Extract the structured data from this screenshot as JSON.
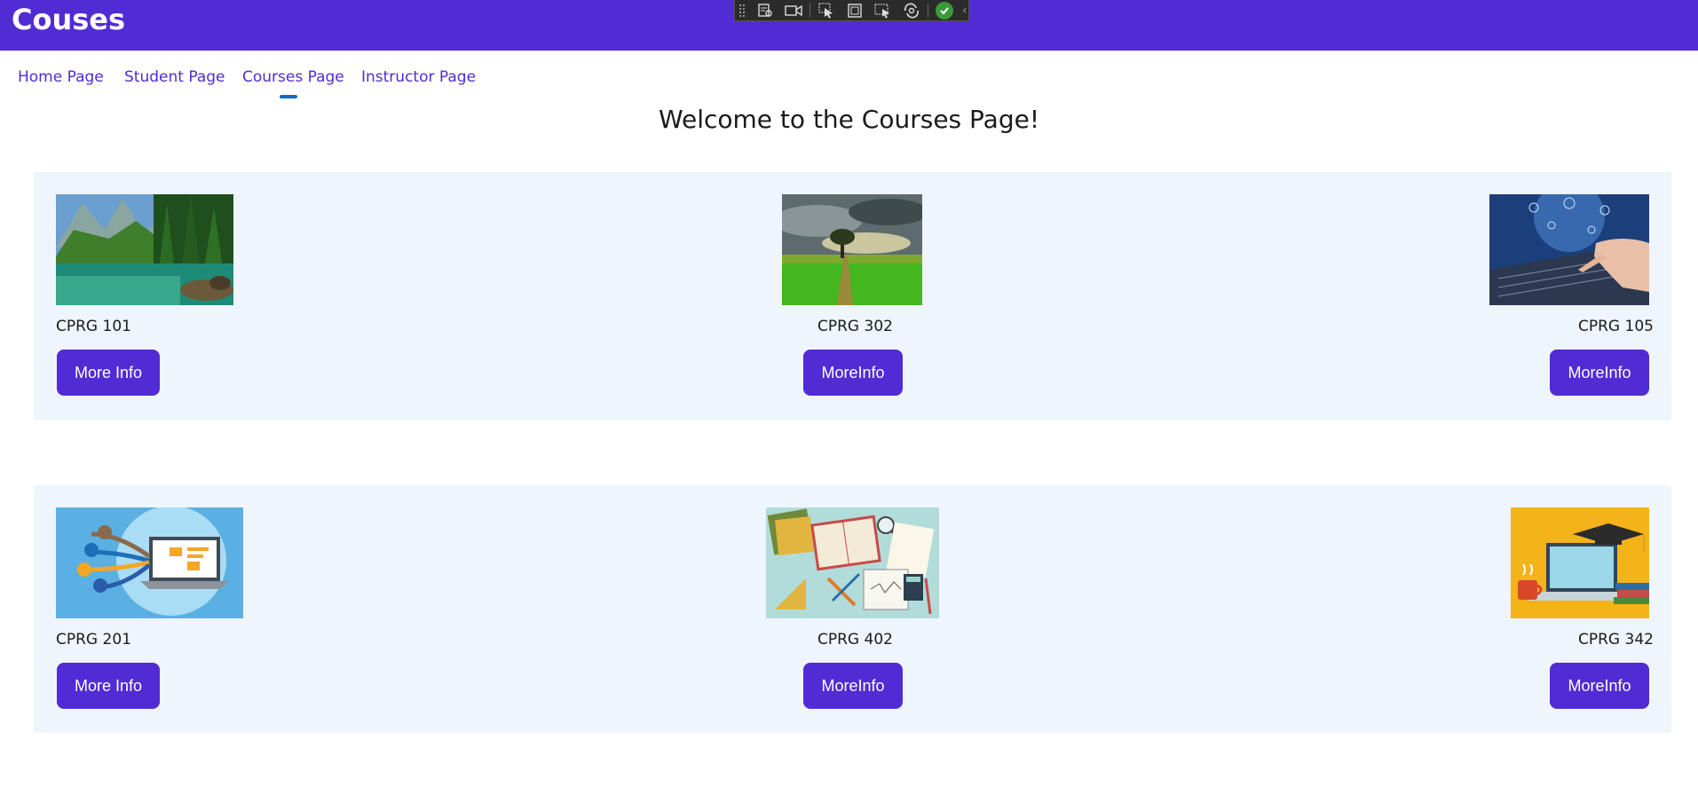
{
  "app": {
    "title": "Couses"
  },
  "nav": {
    "items": [
      {
        "label": "Home Page"
      },
      {
        "label": "Student Page"
      },
      {
        "label": "Courses Page",
        "selected": true
      },
      {
        "label": "Instructor Page"
      }
    ]
  },
  "main": {
    "heading": "Welcome to the Courses Page!"
  },
  "courses": [
    {
      "code": "CPRG 101",
      "button": "More Info"
    },
    {
      "code": "CPRG 302",
      "button": "MoreInfo"
    },
    {
      "code": "CPRG 105",
      "button": "MoreInfo"
    },
    {
      "code": "CPRG 201",
      "button": "More Info"
    },
    {
      "code": "CPRG 402",
      "button": "MoreInfo"
    },
    {
      "code": "CPRG 342",
      "button": "MoreInfo"
    }
  ],
  "colors": {
    "accent": "#512bd4",
    "panel": "#eef5fd",
    "nav_indicator": "#0f6cbd"
  },
  "icons": {
    "debug_toolbar": [
      "live-visual-tree-icon",
      "record-icon",
      "select-element-icon",
      "display-adorners-icon",
      "track-focus-icon",
      "hot-reload-icon",
      "check-icon",
      "collapse-chevron-icon"
    ]
  }
}
